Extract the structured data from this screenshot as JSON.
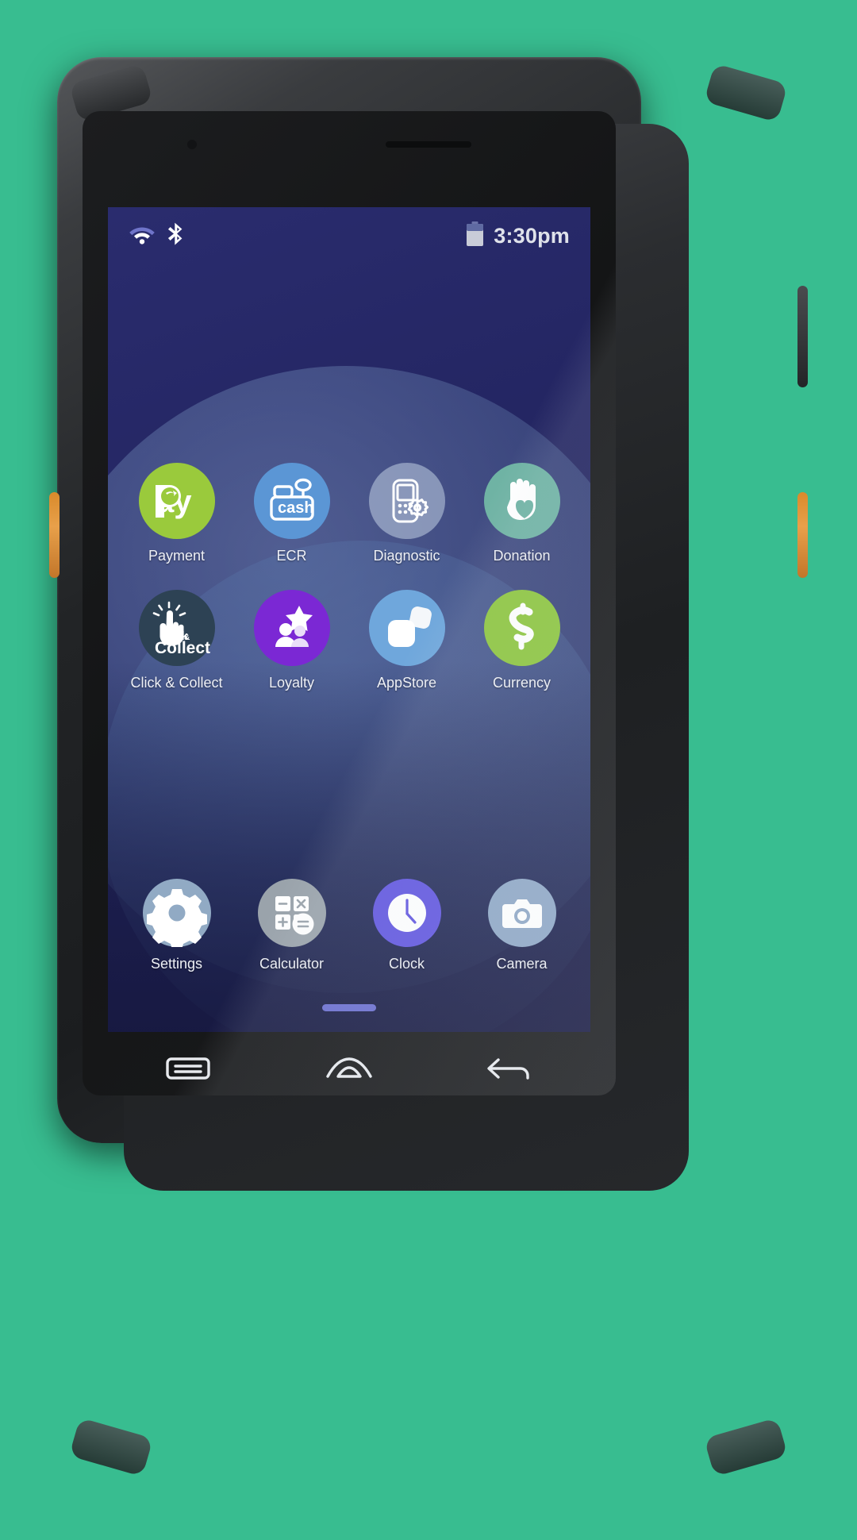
{
  "device": {
    "type": "rugged-android-pos-terminal",
    "body_color": "#26282b",
    "side_key_color": "#e8a04a"
  },
  "status_bar": {
    "wifi_icon": "wifi-icon",
    "bluetooth_icon": "bluetooth-icon",
    "battery_icon": "battery-icon",
    "time": "3:30pm"
  },
  "wallpaper": {
    "base_color": "#242663",
    "arc_color": "#5f7aa8"
  },
  "apps": {
    "rows": [
      [
        {
          "label": "Payment",
          "icon": "payment-icon",
          "icon_text": "Pay",
          "bg": "#9ACA3C",
          "name": "payment"
        },
        {
          "label": "ECR",
          "icon": "cash-register-icon",
          "icon_text": "cash",
          "bg": "#5B96D5",
          "name": "ecr"
        },
        {
          "label": "Diagnostic",
          "icon": "terminal-gear-icon",
          "icon_text": "",
          "bg": "#8FA8C6",
          "name": "diagnostic"
        },
        {
          "label": "Donation",
          "icon": "hand-heart-icon",
          "icon_text": "",
          "bg": "#6FB3A4",
          "name": "donation"
        }
      ],
      [
        {
          "label": "Click & Collect",
          "icon": "click-collect-icon",
          "icon_text": "Click &|Collect",
          "bg": "#2D4254",
          "name": "click-and-collect"
        },
        {
          "label": "Loyalty",
          "icon": "star-people-icon",
          "icon_text": "",
          "bg": "#7B28D4",
          "name": "loyalty"
        },
        {
          "label": "AppStore",
          "icon": "app-squares-icon",
          "icon_text": "",
          "bg": "#6FA7DC",
          "name": "appstore"
        },
        {
          "label": "Currency",
          "icon": "currency-s-icon",
          "icon_text": "",
          "bg": "#8DC63F",
          "name": "currency"
        }
      ],
      [
        {
          "label": "Settings",
          "icon": "gear-icon",
          "icon_text": "",
          "bg": "#91AAC4",
          "name": "settings"
        },
        {
          "label": "Calculator",
          "icon": "calculator-icon",
          "icon_text": "",
          "bg": "#9AA3AB",
          "name": "calculator"
        },
        {
          "label": "Clock",
          "icon": "clock-icon",
          "icon_text": "",
          "bg": "#6257E0",
          "name": "clock"
        },
        {
          "label": "Camera",
          "icon": "camera-icon",
          "icon_text": "",
          "bg": "#8FA8C6",
          "name": "camera"
        }
      ]
    ]
  },
  "nav_bar": {
    "recents_icon": "recents-icon",
    "home_icon": "home-icon",
    "back_icon": "back-icon"
  },
  "home_indicator": {
    "color": "#6b6fd0"
  }
}
